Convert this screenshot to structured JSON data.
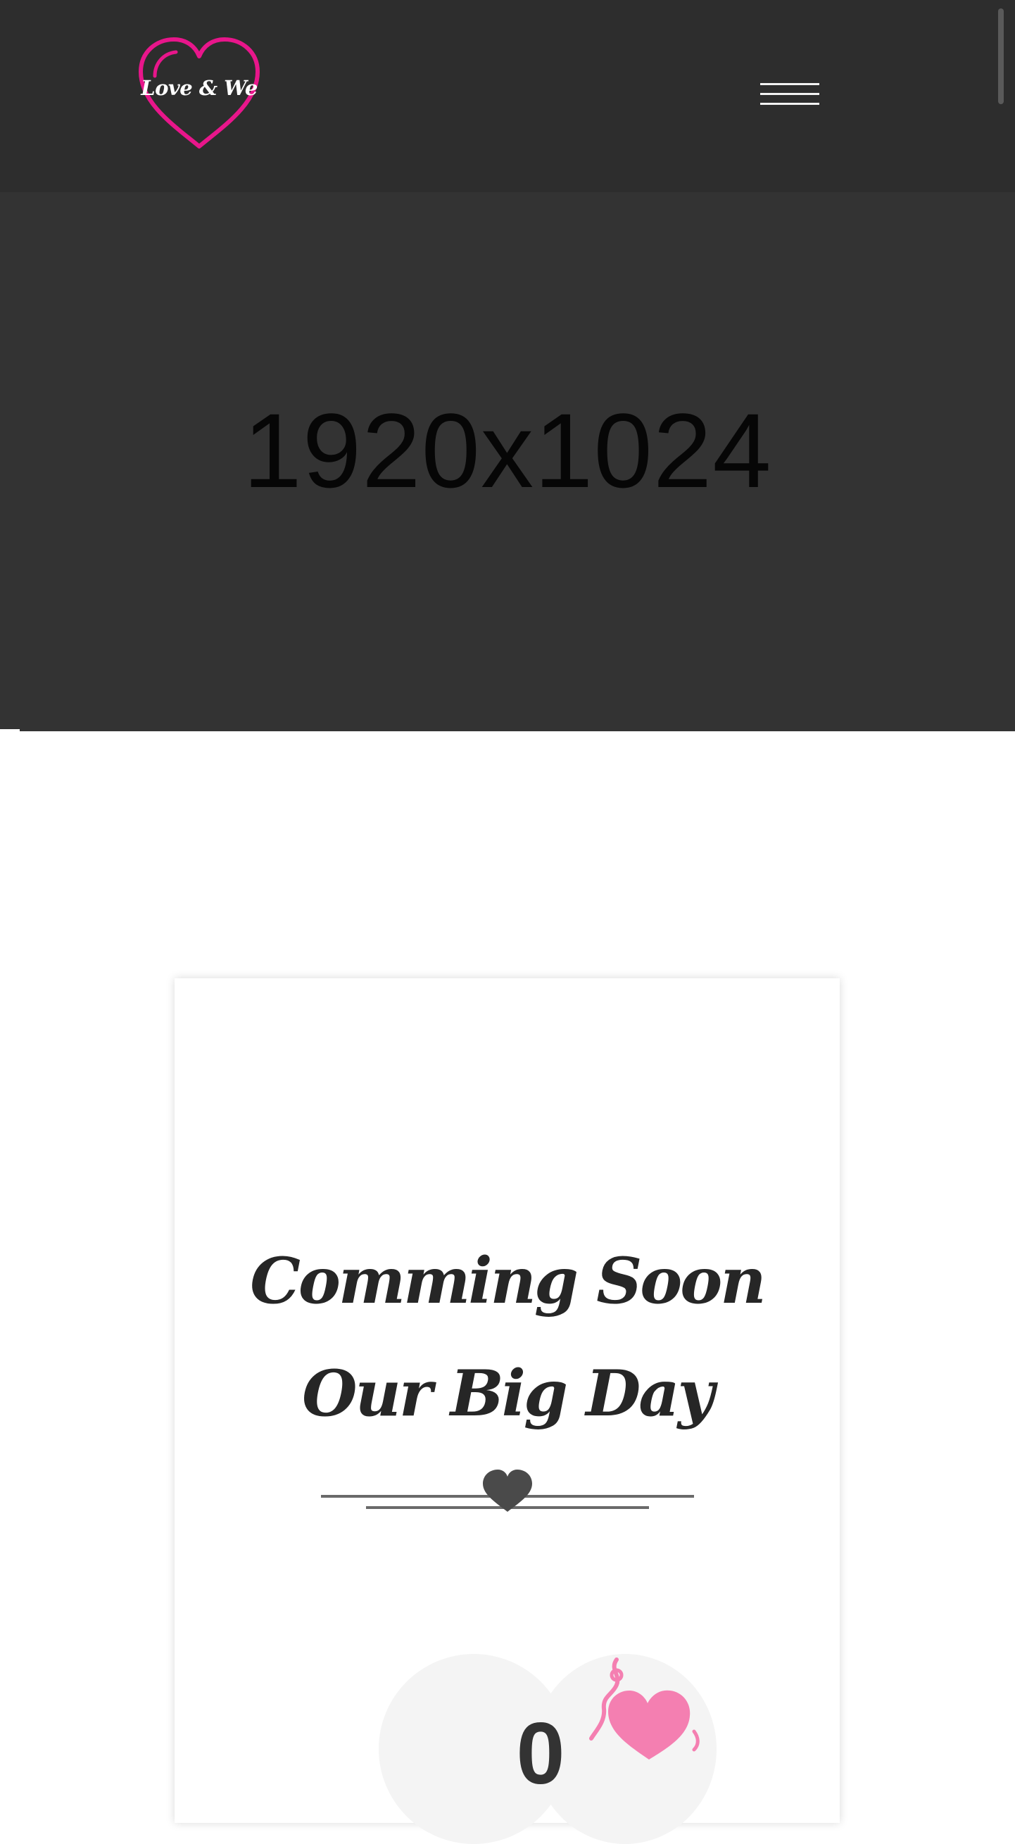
{
  "header": {
    "logo_text": "Love & We",
    "logo_color": "#e8168b",
    "menu_icon": "hamburger-menu-icon",
    "background": "#2d2d2d"
  },
  "hero": {
    "placeholder_text": "1920x1024",
    "subtitle": "",
    "background": "#333333"
  },
  "countdown_card": {
    "title": "Comming Soon Our Big Day",
    "divider_icon": "heart-divider-icon",
    "counter_value": "0",
    "decoration_icon": "pink-heart-decoration-icon",
    "decoration_color": "#f47fb1"
  }
}
